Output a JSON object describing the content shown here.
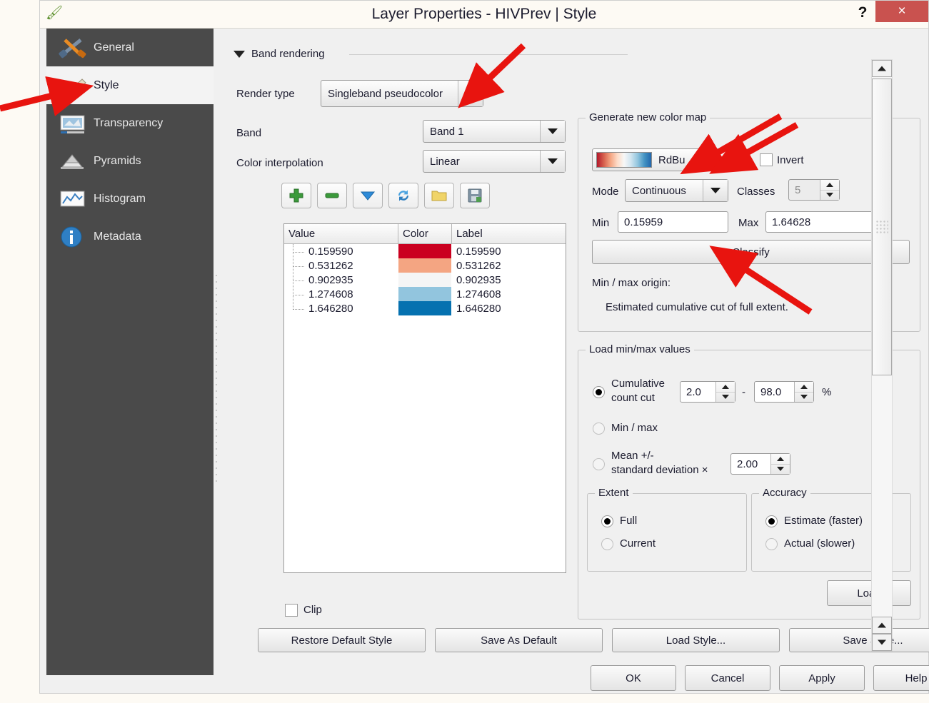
{
  "window": {
    "title": "Layer Properties - HIVPrev | Style",
    "app_icon": "qgis-icon",
    "help_label": "?",
    "close_label": "×"
  },
  "sidebar": {
    "items": [
      {
        "label": "General",
        "icon": "hammer-wrench-icon",
        "selected": false
      },
      {
        "label": "Style",
        "icon": "paintbrush-icon",
        "selected": true
      },
      {
        "label": "Transparency",
        "icon": "transparency-icon",
        "selected": false
      },
      {
        "label": "Pyramids",
        "icon": "pyramids-icon",
        "selected": false
      },
      {
        "label": "Histogram",
        "icon": "histogram-icon",
        "selected": false
      },
      {
        "label": "Metadata",
        "icon": "info-icon",
        "selected": false
      }
    ]
  },
  "band_rendering": {
    "group_title": "Band rendering",
    "expanded": true,
    "render_type_label": "Render type",
    "render_type_value": "Singleband pseudocolor",
    "band_label": "Band",
    "band_value": "Band 1",
    "color_interpolation_label": "Color interpolation",
    "color_interpolation_value": "Linear",
    "toolbar": [
      {
        "name": "add-entry-button",
        "icon": "plus-icon"
      },
      {
        "name": "remove-entry-button",
        "icon": "minus-icon"
      },
      {
        "name": "sort-entries-button",
        "icon": "sort-down-icon"
      },
      {
        "name": "reload-button",
        "icon": "refresh-icon"
      },
      {
        "name": "load-colormap-button",
        "icon": "folder-icon"
      },
      {
        "name": "save-colormap-button",
        "icon": "floppy-icon"
      }
    ],
    "table": {
      "columns": [
        "Value",
        "Color",
        "Label"
      ],
      "rows": [
        {
          "value": "0.159590",
          "color": "#CA0020",
          "label": "0.159590"
        },
        {
          "value": "0.531262",
          "color": "#F4A582",
          "label": "0.531262"
        },
        {
          "value": "0.902935",
          "color": "#F5F5F5",
          "label": "0.902935"
        },
        {
          "value": "1.274608",
          "color": "#92C5DE",
          "label": "1.274608"
        },
        {
          "value": "1.646280",
          "color": "#0571B0",
          "label": "1.646280"
        }
      ]
    },
    "clip_label": "Clip",
    "clip_checked": false
  },
  "generate_color_map": {
    "group_title": "Generate new color map",
    "ramp_value": "RdBu",
    "ramp_colors": [
      "#B2182B",
      "#D6604D",
      "#F4A582",
      "#FDDBC7",
      "#F7F7F7",
      "#D1E5F0",
      "#92C5DE",
      "#4393C3",
      "#2166AC"
    ],
    "invert_label": "Invert",
    "invert_checked": false,
    "mode_label": "Mode",
    "mode_value": "Continuous",
    "classes_label": "Classes",
    "classes_value": "5",
    "classes_enabled": false,
    "min_label": "Min",
    "min_value": "0.15959",
    "max_label": "Max",
    "max_value": "1.64628",
    "classify_label": "Classify",
    "origin_label": "Min / max origin:",
    "origin_value": "Estimated cumulative cut of full extent."
  },
  "load_minmax": {
    "group_title": "Load min/max values",
    "cumulative_label": "Cumulative\ncount cut",
    "cumulative_line1": "Cumulative",
    "cumulative_line2": "count cut",
    "cumulative_selected": true,
    "cut_low": "2.0",
    "cut_dash": "-",
    "cut_high": "98.0",
    "percent_label": "%",
    "minmax_label": "Min / max",
    "minmax_selected": false,
    "mean_line1": "Mean +/-",
    "mean_line2": "standard deviation ×",
    "mean_selected": false,
    "stddev_value": "2.00",
    "extent": {
      "group_title": "Extent",
      "options": [
        {
          "label": "Full",
          "selected": true
        },
        {
          "label": "Current",
          "selected": false
        }
      ]
    },
    "accuracy": {
      "group_title": "Accuracy",
      "options": [
        {
          "label": "Estimate (faster)",
          "selected": true
        },
        {
          "label": "Actual (slower)",
          "selected": false
        }
      ]
    },
    "load_label": "Load"
  },
  "style_buttons": [
    "Restore Default Style",
    "Save As Default",
    "Load Style...",
    "Save Style..."
  ],
  "dialog_buttons": [
    "OK",
    "Cancel",
    "Apply",
    "Help"
  ],
  "annotations": {
    "arrow_color": "#e8140f",
    "count": 5
  },
  "colors": {
    "accent_close": "#c9524f",
    "sidebar_bg": "#4a4a4a",
    "dialog_bg": "#f0f0f0"
  }
}
